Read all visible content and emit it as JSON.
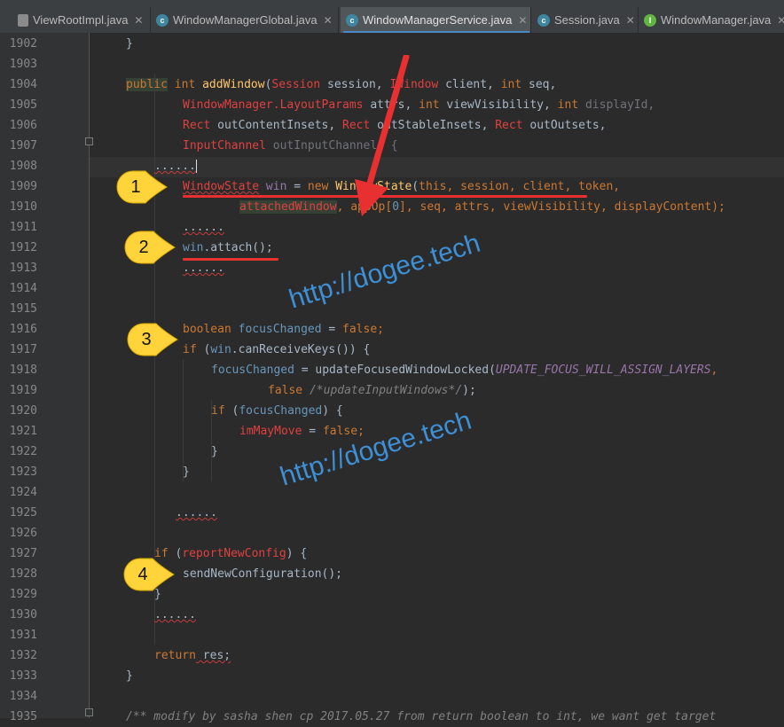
{
  "tabs": [
    {
      "label": "ViewRootImpl.java",
      "icon": "doc-icon",
      "active": false
    },
    {
      "label": "WindowManagerGlobal.java",
      "icon": "class-icon",
      "active": false
    },
    {
      "label": "WindowManagerService.java",
      "icon": "class-icon",
      "active": true
    },
    {
      "label": "Session.java",
      "icon": "class-icon",
      "active": false
    },
    {
      "label": "WindowManager.java",
      "icon": "interface-icon",
      "active": false
    }
  ],
  "tab_close_glyph": "✕",
  "line_numbers": [
    "1902",
    "1903",
    "1904",
    "1905",
    "1906",
    "1907",
    "1908",
    "1909",
    "1910",
    "1911",
    "1912",
    "1913",
    "1914",
    "1915",
    "1916",
    "1917",
    "1918",
    "1919",
    "1920",
    "1921",
    "1922",
    "1923",
    "1924",
    "1925",
    "1926",
    "1927",
    "1928",
    "1929",
    "1930",
    "1931",
    "1932",
    "1933",
    "1934",
    "1935"
  ],
  "code": {
    "l1902": "}",
    "l1904": {
      "kw1": "public",
      "kw2": "int",
      "fn": "addWindow",
      "p1": "(",
      "t1": "Session",
      "a1": " session, ",
      "t2": "IWindow",
      "a2": " client, ",
      "kw3": "int",
      "a3": " seq,"
    },
    "l1905": {
      "t1": "WindowManager.LayoutParams",
      "a1": " attrs, ",
      "kw1": "int",
      "a2": " viewVisibility, ",
      "kw2": "int",
      "a3": " displayId,"
    },
    "l1906": {
      "t1": "Rect",
      "a1": " outContentInsets, ",
      "t2": "Rect",
      "a2": " outStableInsets, ",
      "t3": "Rect",
      "a3": " outOutsets,"
    },
    "l1907": {
      "t1": "InputChannel",
      "a1": " outInputChannel) {"
    },
    "l1908": "......",
    "l1909": {
      "t1": "WindowState",
      "v1": " win",
      "a1": " = ",
      "kw1": "new",
      "a2": " ",
      "fn": "WindowState",
      "a3": "(",
      "kw2": "this",
      "a4": ", session, client, token,"
    },
    "l1910": {
      "a1": "attachedWindow",
      "a2": ", appOp[",
      "n1": "0",
      "a3": "], seq, attrs, viewVisibility, displayContent);"
    },
    "l1911": "......",
    "l1912": {
      "v1": "win",
      "a1": ".attach();"
    },
    "l1913": "......",
    "l1916": {
      "kw1": "boolean",
      "v1": " focusChanged",
      "a1": " = ",
      "kw2": "false",
      "a2": ";"
    },
    "l1917": {
      "kw1": "if",
      "a1": " (",
      "v1": "win",
      "a2": ".canReceiveKeys()) {"
    },
    "l1918": {
      "v1": "focusChanged",
      "a1": " = updateFocusedWindowLocked(",
      "s1": "UPDATE_FOCUS_WILL_ASSIGN_LAYERS",
      "a2": ","
    },
    "l1919": {
      "kw1": "false",
      "c1": " /*updateInputWindows*/",
      "a1": ");"
    },
    "l1920": {
      "kw1": "if",
      "a1": " (",
      "v1": "focusChanged",
      "a2": ") {"
    },
    "l1921": {
      "v1": "imMayMove",
      "a1": " = ",
      "kw1": "false",
      "a2": ";"
    },
    "l1922": "}",
    "l1923": "}",
    "l1925": "......",
    "l1927": {
      "kw1": "if",
      "a1": " (",
      "v1": "reportNewConfig",
      "a2": ") {"
    },
    "l1928": "sendNewConfiguration();",
    "l1929": "}",
    "l1930": "......",
    "l1932": {
      "kw1": "return",
      "a1": " res;"
    },
    "l1933": "}",
    "l1935": "/** modify by sasha shen cp 2017.05.27 from return boolean to int, we want get target"
  },
  "callouts": [
    "1",
    "2",
    "3",
    "4"
  ],
  "watermarks": [
    "http://dogee.tech",
    "http://dogee.tech"
  ],
  "colors": {
    "annotation_red": "#e83030",
    "callout_yellow": "#ffd33a",
    "watermark_blue": "#3d8fd6"
  }
}
